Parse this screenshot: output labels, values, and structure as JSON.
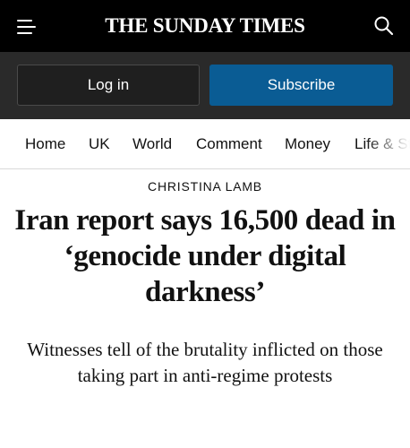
{
  "masthead": "THE SUNDAY TIMES",
  "header": {
    "menu_icon": "hamburger-menu-icon",
    "search_icon": "search-icon"
  },
  "auth": {
    "login_label": "Log in",
    "subscribe_label": "Subscribe"
  },
  "nav": {
    "items": [
      "Home",
      "UK",
      "World",
      "Comment",
      "Money",
      "Life & Style"
    ]
  },
  "article": {
    "author": "CHRISTINA LAMB",
    "headline": "Iran report says 16,500 dead in ‘genocide under digital darkness’",
    "standfirst": "Witnesses tell of the brutality inflicted on those taking part in anti-regime protests"
  },
  "colors": {
    "header_bg": "#000000",
    "auth_bar_bg": "#2a2a2a",
    "subscribe_bg": "#0a5c94",
    "text": "#111111"
  }
}
